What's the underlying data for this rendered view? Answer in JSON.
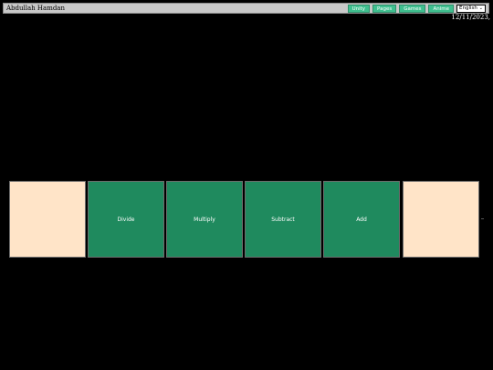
{
  "header": {
    "site_name": "Abdullah Hamdan",
    "nav": [
      "Unity",
      "Pages",
      "Games",
      "Anime"
    ],
    "language": {
      "selected": "English",
      "icon": "chevron-down-icon"
    },
    "date": "12/11/2023,"
  },
  "tiles": [
    {
      "label": ""
    },
    {
      "label": "Divide"
    },
    {
      "label": "Multiply"
    },
    {
      "label": "Subtract"
    },
    {
      "label": "Add"
    },
    {
      "label": ""
    }
  ],
  "colors": {
    "background": "#000000",
    "nav_button": "#3fbf8f",
    "operation_tile": "#1f8a5e",
    "blank_tile": "#ffe4c8"
  }
}
